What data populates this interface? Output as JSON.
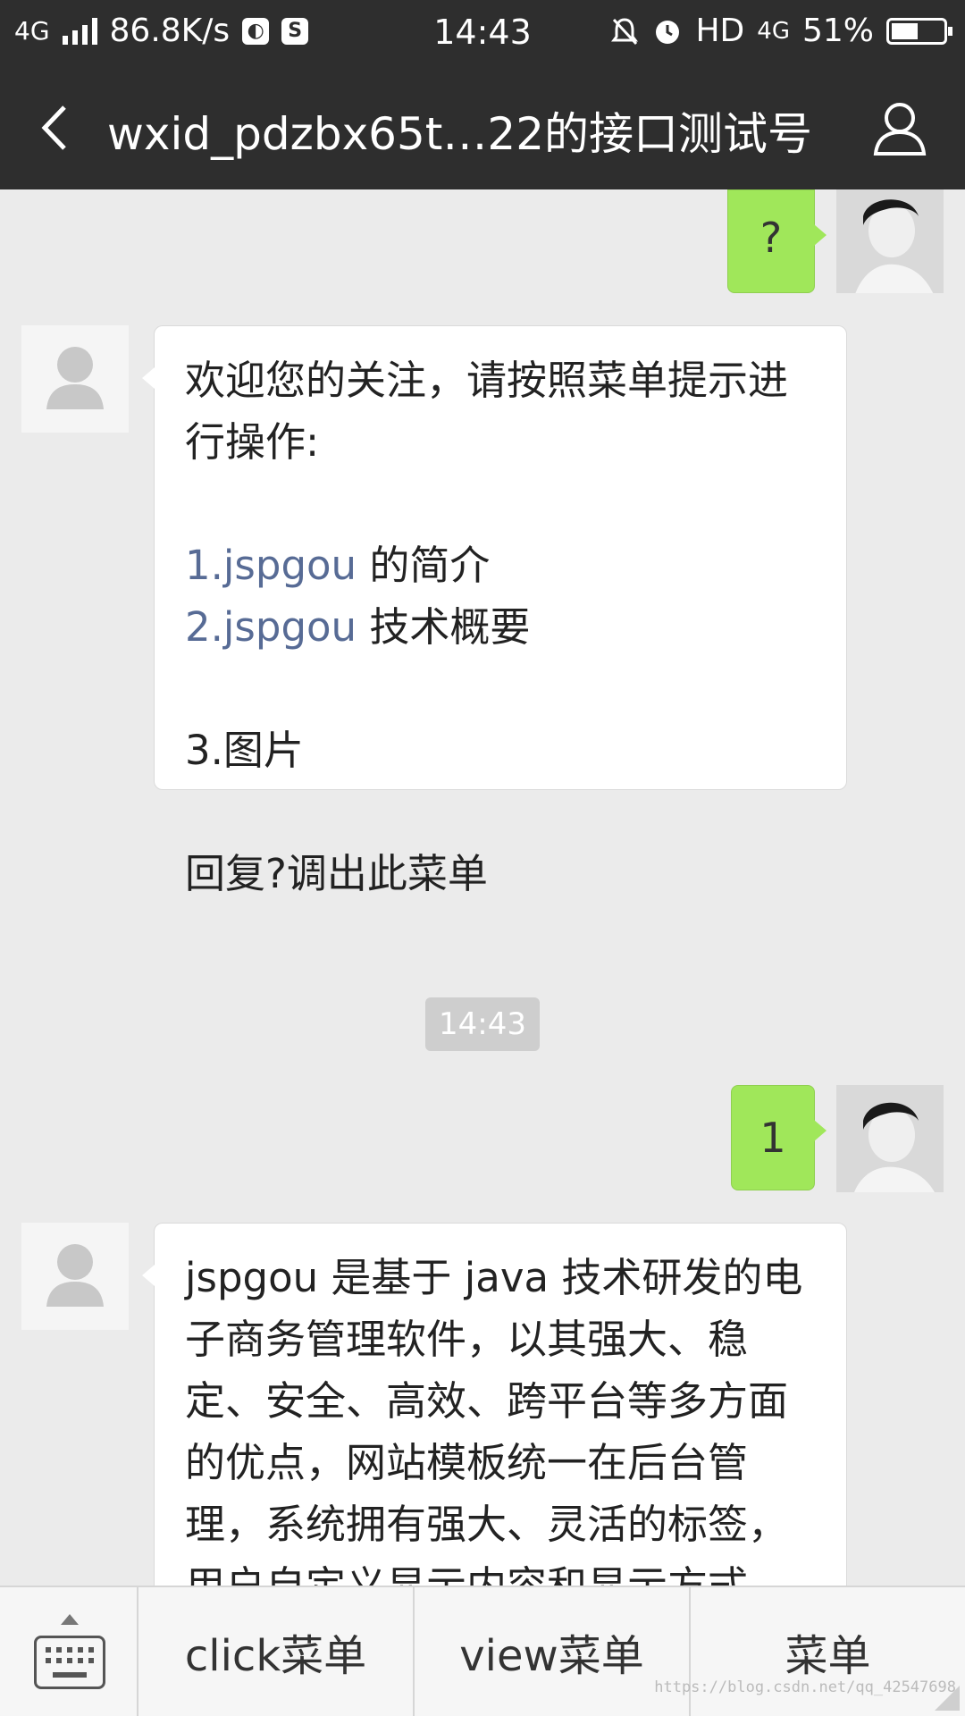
{
  "status_bar": {
    "network": "4G",
    "speed": "86.8K/s",
    "time": "14:43",
    "hd": "HD",
    "net_type": "4G",
    "battery": "51%",
    "battery_level": 0.51
  },
  "nav": {
    "title": "wxid_pdzbx65t…22的接口测试号"
  },
  "messages": [
    {
      "from": "me",
      "text": "?"
    },
    {
      "from": "official",
      "lines": [
        "欢迎您的关注，请按照菜单提示进",
        "行操作:",
        "",
        {
          "link": "1.jspgou",
          "rest": " 的简介"
        },
        {
          "link": "2.jspgou",
          "rest": " 技术概要"
        },
        "",
        "3.图片",
        "",
        "回复?调出此菜单"
      ]
    },
    {
      "type": "timestamp",
      "text": "14:43"
    },
    {
      "from": "me",
      "text": "1"
    },
    {
      "from": "official",
      "text": "jspgou 是基于 java 技术研发的电子商务管理软件，以其强大、稳定、安全、高效、跨平台等多方面的优点，网站模板统一在后台管理，系统拥有强大、灵活的标签，用户自定义显示内容和显示方式"
    }
  ],
  "menu": {
    "items": [
      "click菜单",
      "view菜单",
      "菜单"
    ]
  },
  "watermark": "https://blog.csdn.net/qq_42547698",
  "colors": {
    "header_bg": "#2e2e2e",
    "chat_bg": "#ebebeb",
    "my_bubble": "#a0e75a",
    "link": "#576b95"
  },
  "icons": [
    "back-icon",
    "profile-icon",
    "default-avatar-icon",
    "keyboard-icon"
  ]
}
